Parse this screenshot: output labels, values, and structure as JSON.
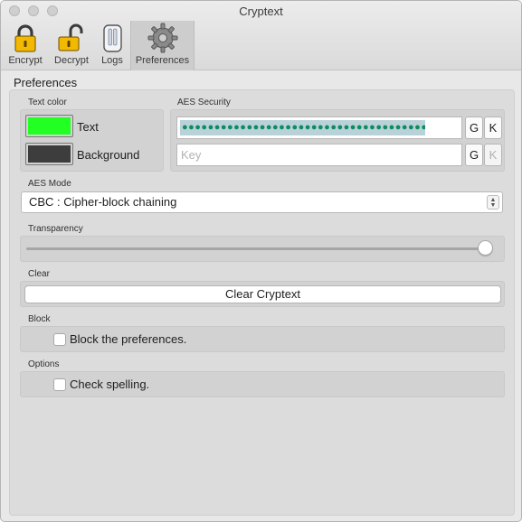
{
  "window": {
    "title": "Cryptext"
  },
  "toolbar": {
    "items": [
      {
        "label": "Encrypt",
        "icon": "lock-closed-icon"
      },
      {
        "label": "Decrypt",
        "icon": "lock-open-icon"
      },
      {
        "label": "Logs",
        "icon": "logs-icon"
      },
      {
        "label": "Preferences",
        "icon": "gear-icon"
      }
    ],
    "active": "Preferences"
  },
  "preferences": {
    "title": "Preferences",
    "text_color": {
      "label": "Text color",
      "text_swatch_label": "Text",
      "text_color": "#22ff22",
      "background_swatch_label": "Background",
      "background_color": "#3d3d3d"
    },
    "aes_security": {
      "label": "AES Security",
      "secret_value": "●●●●●●●●●●●●●●●●●●●●●●●●●●●●●●●●●●●●●●●●●●●",
      "secret_generate": "G",
      "secret_keychain": "K",
      "key_placeholder": "Key",
      "key_generate": "G",
      "key_keychain": "K"
    },
    "aes_mode": {
      "label": "AES Mode",
      "selected": "CBC : Cipher-block chaining"
    },
    "transparency": {
      "label": "Transparency",
      "value": 1.0
    },
    "clear": {
      "label": "Clear",
      "button_label": "Clear Cryptext"
    },
    "block": {
      "label": "Block",
      "checkbox_label": "Block the preferences.",
      "checked": false
    },
    "options": {
      "label": "Options",
      "checkbox_label": "Check spelling.",
      "checked": false
    }
  }
}
